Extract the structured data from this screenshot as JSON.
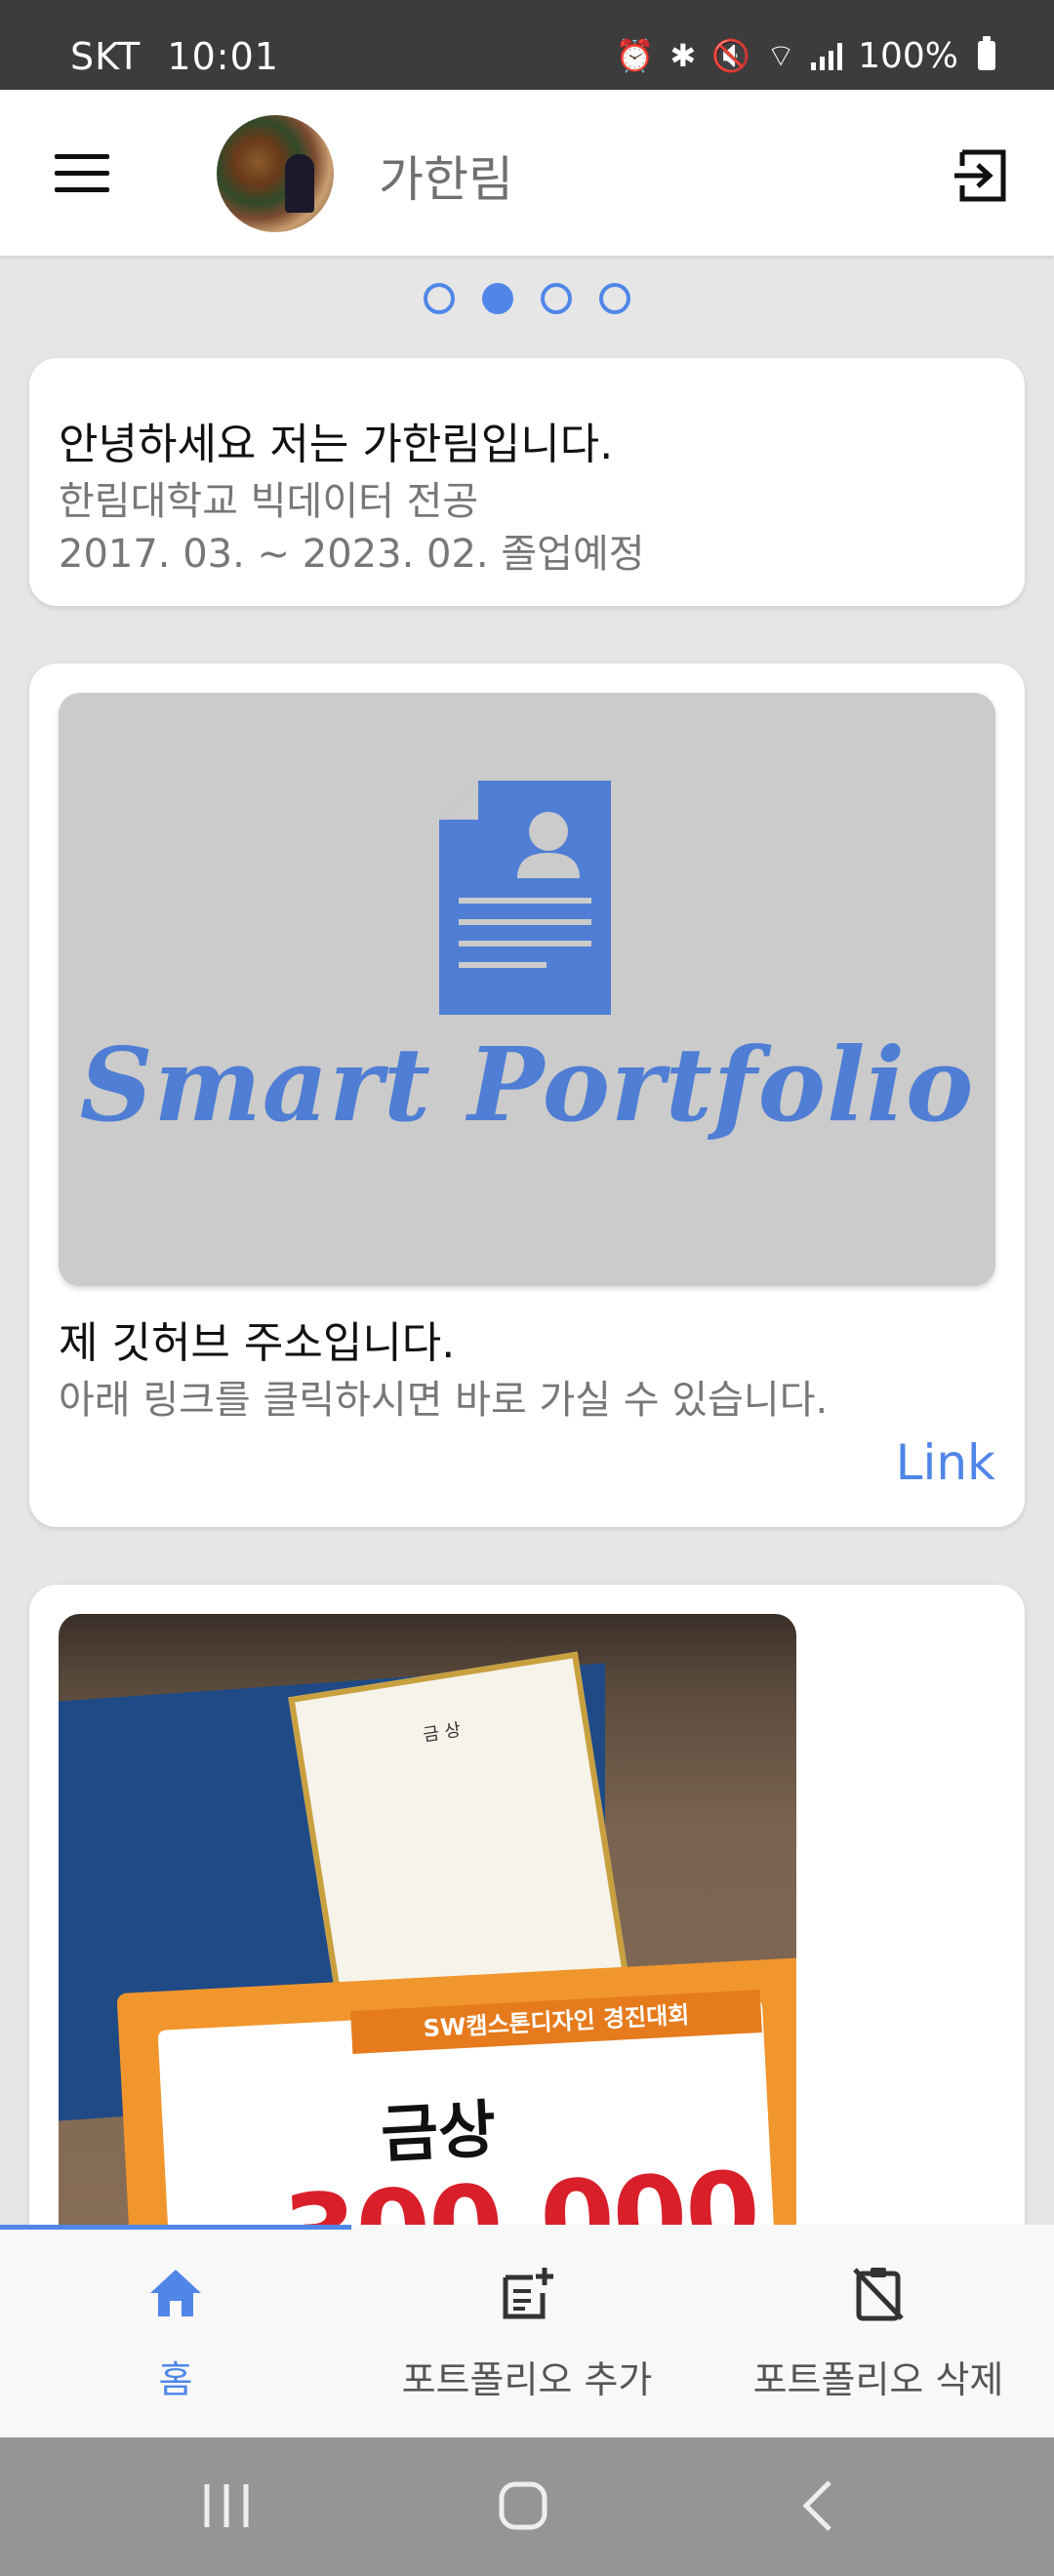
{
  "status_bar": {
    "carrier": "SKT",
    "time": "10:01",
    "battery": "100%",
    "icons": [
      "alarm-icon",
      "bluetooth-icon",
      "mute-icon",
      "wifi-icon",
      "signal-icon",
      "battery-icon"
    ]
  },
  "header": {
    "user_name": "가한림",
    "menu_icon": "menu-icon",
    "logout_icon": "logout-icon"
  },
  "carousel": {
    "page_count": 4,
    "active_index": 1
  },
  "cards": {
    "intro": {
      "title": "안녕하세요 저는 가한림입니다.",
      "subtitle": "한림대학교 빅데이터 전공",
      "period": "2017. 03. ~ 2023. 02. 졸업예정"
    },
    "github": {
      "banner_text": "Smart Portfolio",
      "title": "제 깃허브 주소입니다.",
      "subtitle": "아래 링크를 클릭하시면 바로 가실 수 있습니다.",
      "link_label": "Link"
    },
    "award": {
      "certificate_title": "금 상",
      "banner_text": "SW캠스톤디자인 경진대회",
      "award_text": "금상",
      "amount_text": "300,000"
    }
  },
  "bottom_nav": {
    "items": [
      {
        "label": "홈",
        "icon": "home-icon",
        "active": true
      },
      {
        "label": "포트폴리오 추가",
        "icon": "add-note-icon",
        "active": false
      },
      {
        "label": "포트폴리오 삭제",
        "icon": "delete-clipboard-icon",
        "active": false
      }
    ]
  },
  "colors": {
    "accent": "#4f86e8",
    "status_bar": "#3c3c3c",
    "background": "#e6e6e6",
    "system_nav": "#959595"
  }
}
